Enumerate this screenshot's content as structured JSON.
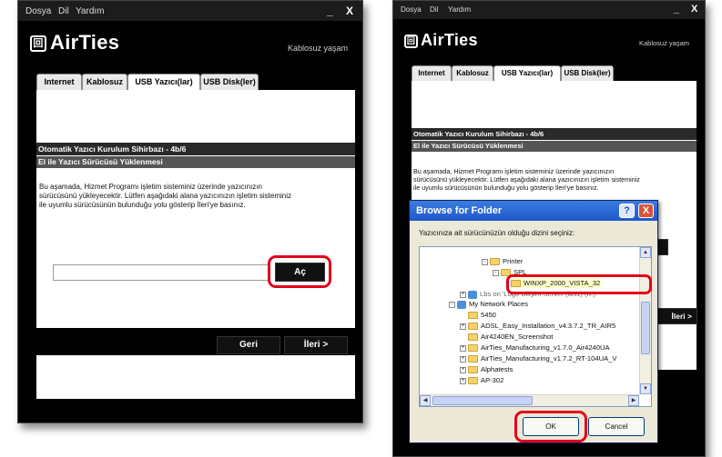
{
  "left_window": {
    "menu": {
      "file": "Dosya",
      "view": "Dil",
      "help": "Yardım",
      "minimize": "_",
      "close": "X"
    },
    "brand": {
      "logo_glyph": "回",
      "name": "AirTies",
      "tagline": "Kablosuz yaşam"
    },
    "tabs": [
      "Internet",
      "Kablosuz",
      "USB Yazıcı(lar)",
      "USB Disk(ler)"
    ],
    "wizard_title": "Otomatik Yazıcı Kurulum Sihirbazı - 4b/6",
    "step_title": "El ile Yazıcı Sürücüsü Yüklenmesi",
    "description_lines": [
      "Bu aşamada, Hizmet Programı işletim sisteminiz üzerinde yazıcınızın",
      "sürücüsünü yükleyecektir. Lütfen aşağıdaki alana yazıcınızın işletim sisteminiz",
      "ile uyumlu sürücüsünün bulunduğu yolu gösterip İleri'ye basınız."
    ],
    "path_input": {
      "value": ""
    },
    "open_button": "Aç",
    "back_button": "Geri",
    "next_button": "İleri >"
  },
  "right_window": {
    "menu": {
      "file": "Dosya",
      "view": "Dil",
      "help": "Yardım",
      "minimize": "_",
      "close": "X"
    },
    "brand": {
      "logo_glyph": "回",
      "name": "AirTies",
      "tagline": "Kablosuz yaşam"
    },
    "tabs": [
      "Internet",
      "Kablosuz",
      "USB Yazıcı(lar)",
      "USB Disk(ler)"
    ],
    "wizard_title": "Otomatik Yazıcı Kurulum Sihirbazı - 4b/6",
    "step_title": "El ile Yazıcı Sürücüsü Yüklenmesi",
    "description_lines": [
      "Bu aşamada, Hizmet Programı işletim sisteminiz üzerinde yazıcınızın",
      "sürücüsünü yükleyecektir. Lütfen aşağıdaki alana yazıcınızın işletim sisteminiz",
      "ile uyumlu sürücüsünün bulunduğu yolu gösterip İleri'ye basınız."
    ],
    "next_button": "İleri >"
  },
  "dialog": {
    "title": "Browse for Folder",
    "help_glyph": "?",
    "close_glyph": "X",
    "prompt": "Yazıcınıza ait sürücünüzün olduğu dizini seçiniz:",
    "tree": [
      {
        "expander": "-",
        "icon": "folder",
        "label": "Printer"
      },
      {
        "expander": "-",
        "icon": "folder",
        "label": "SPL"
      },
      {
        "expander": "",
        "icon": "folder",
        "label": "WINXP_2000_VISTA_32",
        "selected": true
      },
      {
        "expander": "+",
        "icon": "network",
        "label": "Lbs on 'Logo Bilişim Server (lbs1) (K:)"
      },
      {
        "expander": "-",
        "icon": "network",
        "label": "My Network Places"
      },
      {
        "expander": "",
        "icon": "folder",
        "label": "5450"
      },
      {
        "expander": "+",
        "icon": "folder",
        "label": "ADSL_Easy_Installation_v4.3.7.2_TR_AIR5"
      },
      {
        "expander": "",
        "icon": "folder",
        "label": "Air4240EN_Screenshot"
      },
      {
        "expander": "+",
        "icon": "folder",
        "label": "AirTies_Manufacturing_v1.7.0_Air4240UA"
      },
      {
        "expander": "+",
        "icon": "folder",
        "label": "AirTies_Manufacturing_v1.7.2_RT-104UA_V"
      },
      {
        "expander": "+",
        "icon": "folder",
        "label": "Alphatests"
      },
      {
        "expander": "+",
        "icon": "folder",
        "label": "AP-302"
      }
    ],
    "ok_button": "OK",
    "cancel_button": "Cancel"
  },
  "colors": {
    "accent_red": "#e2001a",
    "window_bg": "#000000",
    "xp_title_blue": "#1e58c9"
  }
}
